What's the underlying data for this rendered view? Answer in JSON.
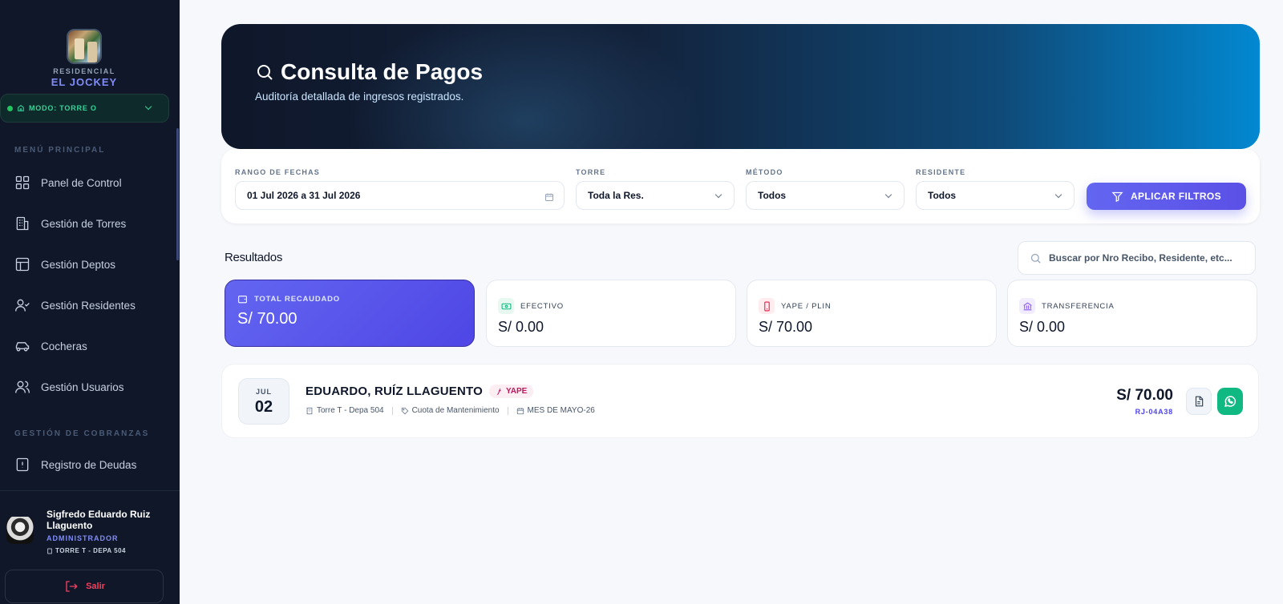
{
  "brand": {
    "sub": "RESIDENCIAL",
    "name": "EL JOCKEY"
  },
  "mode": {
    "label": "MODO: TORRE O"
  },
  "sidebar": {
    "section_main": "MENÚ PRINCIPAL",
    "section_cobranzas": "GESTIÓN DE COBRANZAS",
    "items": [
      {
        "label": "Panel de Control",
        "icon": "grid-icon"
      },
      {
        "label": "Gestión de Torres",
        "icon": "building-icon"
      },
      {
        "label": "Gestión Deptos",
        "icon": "layout-icon"
      },
      {
        "label": "Gestión Residentes",
        "icon": "user-check-icon"
      },
      {
        "label": "Cocheras",
        "icon": "car-icon"
      },
      {
        "label": "Gestión Usuarios",
        "icon": "users-icon"
      },
      {
        "label": "Registro de Deudas",
        "icon": "alert-file-icon"
      }
    ]
  },
  "user": {
    "name": "Sigfredo Eduardo Ruiz Llaguento",
    "role": "ADMINISTRADOR",
    "location": "TORRE T - DEPA 504",
    "logout_label": "Salir"
  },
  "hero": {
    "title": "Consulta de Pagos",
    "subtitle": "Auditoría detallada de ingresos registrados."
  },
  "filters": {
    "date_label": "RANGO DE FECHAS",
    "date_value": "01 Jul 2026 a 31 Jul 2026",
    "tower_label": "TORRE",
    "tower_value": "Toda la Res.",
    "method_label": "MÉTODO",
    "method_value": "Todos",
    "resident_label": "RESIDENTE",
    "resident_value": "Todos",
    "apply_label": "APLICAR FILTROS"
  },
  "results": {
    "title": "Resultados",
    "search_placeholder": "Buscar por Nro Recibo, Residente, etc..."
  },
  "stats": [
    {
      "label": "TOTAL RECAUDADO",
      "value": "S/ 70.00",
      "icon": "wallet-icon",
      "color": "#ffffff"
    },
    {
      "label": "EFECTIVO",
      "value": "S/ 0.00",
      "icon": "cash-icon",
      "color": "#10b981"
    },
    {
      "label": "YAPE / PLIN",
      "value": "S/ 70.00",
      "icon": "phone-icon",
      "color": "#e11d48"
    },
    {
      "label": "TRANSFERENCIA",
      "value": "S/ 0.00",
      "icon": "bank-icon",
      "color": "#8b5cf6"
    }
  ],
  "payments": [
    {
      "month": "JUL",
      "day": "02",
      "payer": "EDUARDO, RUÍZ LLAGUENTO",
      "method": "YAPE",
      "unit": "Torre T - Depa 504",
      "concept": "Cuota de Mantenimiento",
      "period": "MES DE MAYO-26",
      "amount": "S/ 70.00",
      "receipt": "RJ-04A38"
    }
  ],
  "colors": {
    "sidebar_bg": "#0f1729",
    "accent": "#6366f1",
    "whatsapp": "#10b981",
    "yape": "#be185d"
  }
}
